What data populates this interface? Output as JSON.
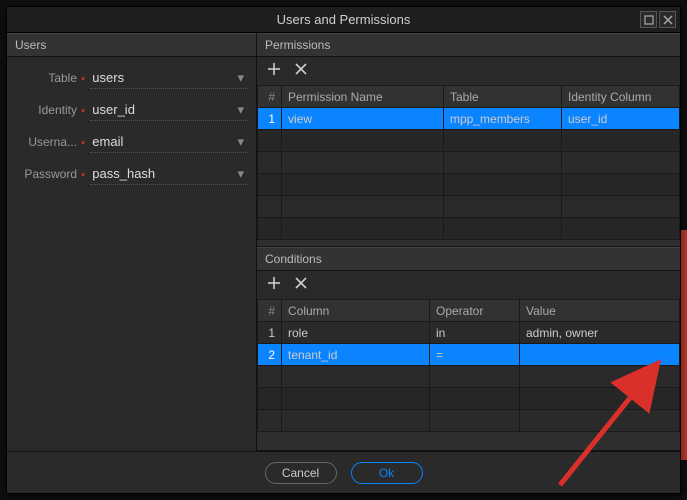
{
  "window": {
    "title": "Users and Permissions"
  },
  "users": {
    "header": "Users",
    "fields": {
      "table_label": "Table",
      "table_value": "users",
      "identity_label": "Identity",
      "identity_value": "user_id",
      "username_label": "Userna...",
      "username_value": "email",
      "password_label": "Password",
      "password_value": "pass_hash"
    }
  },
  "permissions": {
    "header": "Permissions",
    "columns": {
      "num": "#",
      "name": "Permission Name",
      "table": "Table",
      "identity": "Identity Column"
    },
    "rows": [
      {
        "num": "1",
        "name": "view",
        "table": "mpp_members",
        "identity": "user_id",
        "selected": true
      }
    ]
  },
  "conditions": {
    "header": "Conditions",
    "columns": {
      "num": "#",
      "column": "Column",
      "operator": "Operator",
      "value": "Value"
    },
    "rows": [
      {
        "num": "1",
        "column": "role",
        "operator": "in",
        "value": "admin, owner",
        "selected": false
      },
      {
        "num": "2",
        "column": "tenant_id",
        "operator": "=",
        "value": "",
        "selected": true
      }
    ]
  },
  "footer": {
    "cancel": "Cancel",
    "ok": "Ok"
  }
}
